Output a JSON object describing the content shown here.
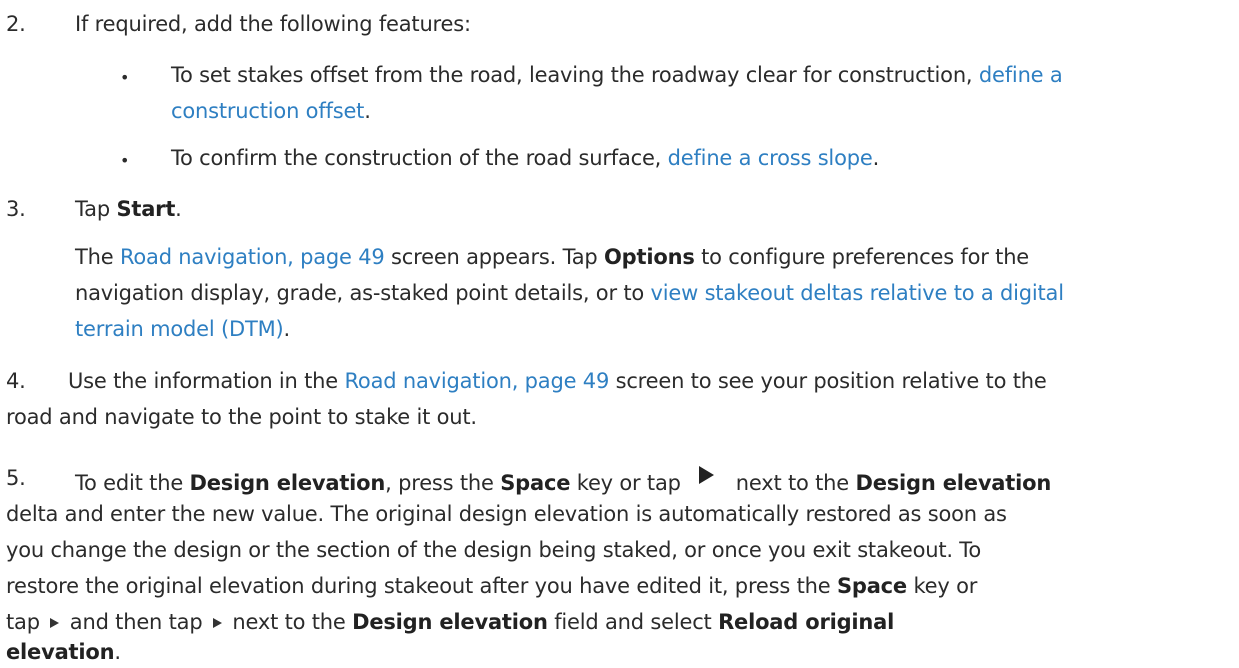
{
  "step2": {
    "num": "2.",
    "text": "If required, add the following features:",
    "bullet1": {
      "pre": "To set stakes offset from the road, leaving the roadway clear for construction, ",
      "link_a": "define a",
      "link_b": "construction offset",
      "post": "."
    },
    "bullet2": {
      "pre": "To confirm the construction of the road surface, ",
      "link": "define a cross slope",
      "post": "."
    }
  },
  "step3": {
    "num": "3.",
    "tap": "Tap ",
    "start": "Start",
    "period": ".",
    "para": {
      "pre": "The ",
      "link1": "Road navigation, page 49",
      "mid1": " screen appears. Tap ",
      "options": "Options",
      "mid2": " to configure preferences for the",
      "line2_pre": "navigation display, grade, as-staked point details, or to ",
      "link2a": "view stakeout deltas relative to a digital",
      "link2b": "terrain model (DTM)",
      "post": "."
    }
  },
  "step4": {
    "num": "4.",
    "pre": " Use the information in the ",
    "link": "Road navigation, page 49",
    "mid": " screen to see your position relative to the",
    "line2": "road and navigate to the point to stake it out."
  },
  "step5": {
    "num": "5.",
    "l1_a": "To edit the ",
    "design_elevation": "Design elevation",
    "l1_b": ", press the ",
    "space": "Space",
    "l1_c": " key or tap",
    "l1_d": "next to the ",
    "l2": "delta and enter the new value. The original design elevation is automatically restored as soon as",
    "l3": "you change the design or the section of the design being staked, or once you exit stakeout. To",
    "l4_a": "restore the original elevation during stakeout after you have edited it, press the ",
    "l4_b": " key or",
    "l5_a": "tap ",
    "l5_b": " and then tap ",
    "l5_c": " next to the ",
    "l5_d": " field and select ",
    "reload": "Reload original",
    "elevation": "elevation",
    "period": "."
  }
}
